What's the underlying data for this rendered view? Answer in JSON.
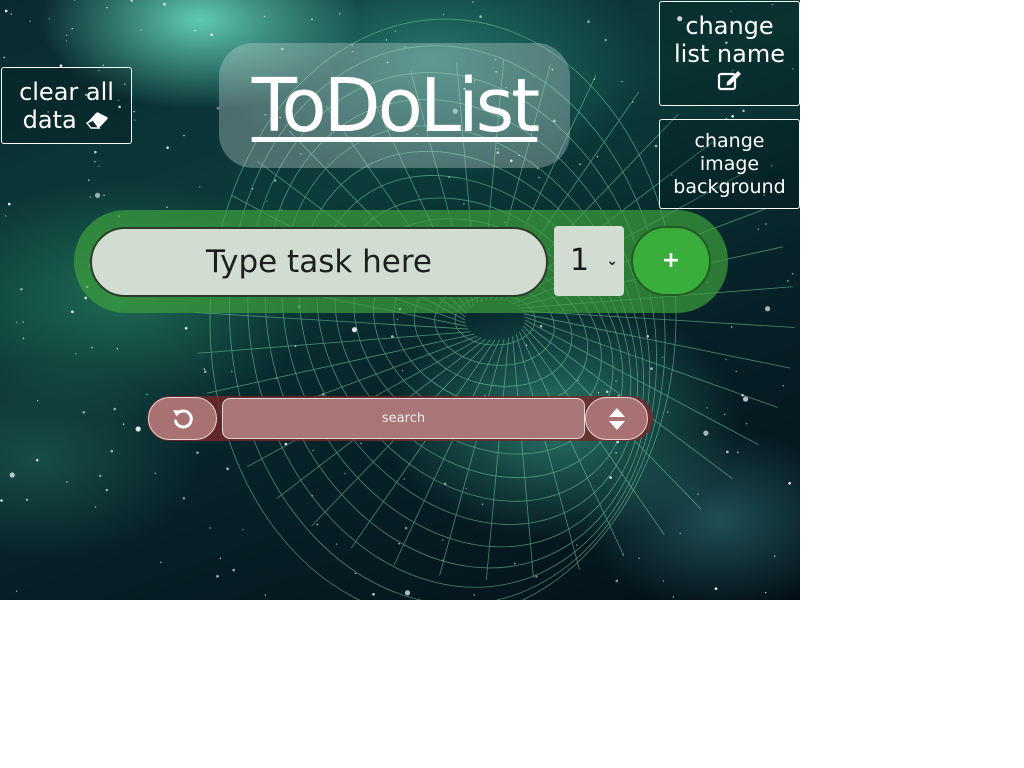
{
  "app": {
    "title": "ToDoList"
  },
  "toolbar": {
    "clear_all_label": "clear all data",
    "clear_all_line1": "clear all",
    "clear_all_line2": "data",
    "change_name_line1": "change",
    "change_name_line2": "list name",
    "change_background_line1": "change",
    "change_background_line2": "image",
    "change_background_line3": "background"
  },
  "task_form": {
    "input_placeholder": "Type task here",
    "input_value": "",
    "priority_selected": "1",
    "add_label": "+"
  },
  "search": {
    "placeholder": "search",
    "value": ""
  },
  "icons": {
    "clear": "eraser-icon",
    "rename": "edit-icon",
    "refresh": "refresh-icon",
    "sort": "sort-icon",
    "priority_dropdown": "chevron-down-icon"
  },
  "colors": {
    "add_bar": "#3ca03c",
    "add_button": "#3aae3a",
    "search_bar": "#782828",
    "search_controls": "#a87272",
    "input_fill": "#d0ddd0"
  }
}
